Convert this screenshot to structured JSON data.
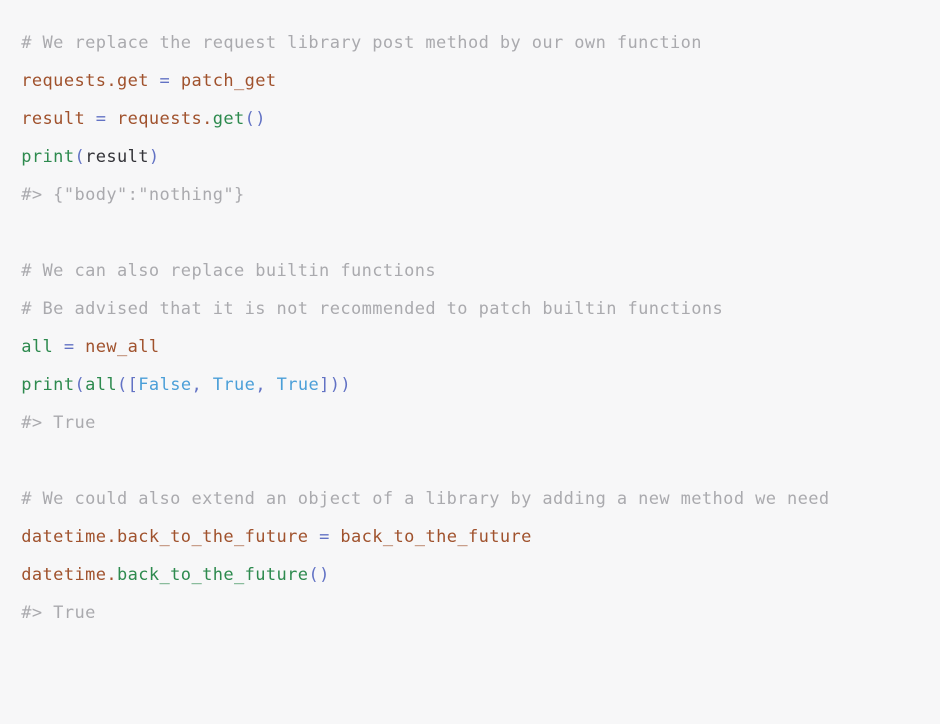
{
  "block": {
    "name": "python-code-snippet",
    "language": "python",
    "background_color": "#f7f7f8",
    "font_size_px": 17,
    "line_height_px": 38
  },
  "palette": {
    "comment": "#aaaaae",
    "name": "#a0522d",
    "function": "#2d8a4e",
    "operator": "#6272c4",
    "punctuation": "#6272c4",
    "boolean": "#4b9fd8",
    "plain": "#333338",
    "background": "#f7f7f8"
  },
  "lines": [
    {
      "id": "line-1",
      "kind": "comment",
      "text": "  # We replace the request library post method by our own function",
      "tokens": [
        {
          "t": "  ",
          "c": "ws"
        },
        {
          "t": "# We replace the request library post method by our own function",
          "c": "comment"
        }
      ]
    },
    {
      "id": "line-2",
      "kind": "code",
      "text": "  requests.get = patch_get",
      "tokens": [
        {
          "t": "  ",
          "c": "ws"
        },
        {
          "t": "requests.get",
          "c": "name"
        },
        {
          "t": " ",
          "c": "ws"
        },
        {
          "t": "=",
          "c": "op"
        },
        {
          "t": " ",
          "c": "ws"
        },
        {
          "t": "patch_get",
          "c": "name"
        }
      ]
    },
    {
      "id": "line-3",
      "kind": "code",
      "text": "  result = requests.get()",
      "tokens": [
        {
          "t": "  ",
          "c": "ws"
        },
        {
          "t": "result",
          "c": "name"
        },
        {
          "t": " ",
          "c": "ws"
        },
        {
          "t": "=",
          "c": "op"
        },
        {
          "t": " ",
          "c": "ws"
        },
        {
          "t": "requests.",
          "c": "name"
        },
        {
          "t": "get",
          "c": "func"
        },
        {
          "t": "()",
          "c": "punc"
        }
      ]
    },
    {
      "id": "line-4",
      "kind": "code",
      "text": "  print(result)",
      "tokens": [
        {
          "t": "  ",
          "c": "ws"
        },
        {
          "t": "print",
          "c": "func"
        },
        {
          "t": "(",
          "c": "punc"
        },
        {
          "t": "result",
          "c": "plain"
        },
        {
          "t": ")",
          "c": "punc"
        }
      ]
    },
    {
      "id": "line-5",
      "kind": "comment",
      "text": "  #> {\"body\":\"nothing\"}",
      "tokens": [
        {
          "t": "  ",
          "c": "ws"
        },
        {
          "t": "#> {\"body\":\"nothing\"}",
          "c": "comment"
        }
      ]
    },
    {
      "id": "line-6",
      "kind": "blank",
      "text": "",
      "tokens": []
    },
    {
      "id": "line-7",
      "kind": "comment",
      "text": "  # We can also replace builtin functions",
      "tokens": [
        {
          "t": "  ",
          "c": "ws"
        },
        {
          "t": "# We can also replace builtin functions",
          "c": "comment"
        }
      ]
    },
    {
      "id": "line-8",
      "kind": "comment",
      "text": "  # Be advised that it is not recommended to patch builtin functions",
      "tokens": [
        {
          "t": "  ",
          "c": "ws"
        },
        {
          "t": "# Be advised that it is not recommended to patch builtin functions",
          "c": "comment"
        }
      ]
    },
    {
      "id": "line-9",
      "kind": "code",
      "text": "  all = new_all",
      "tokens": [
        {
          "t": "  ",
          "c": "ws"
        },
        {
          "t": "all",
          "c": "func"
        },
        {
          "t": " ",
          "c": "ws"
        },
        {
          "t": "=",
          "c": "op"
        },
        {
          "t": " ",
          "c": "ws"
        },
        {
          "t": "new_all",
          "c": "name"
        }
      ]
    },
    {
      "id": "line-10",
      "kind": "code",
      "text": "  print(all([False, True, True]))",
      "tokens": [
        {
          "t": "  ",
          "c": "ws"
        },
        {
          "t": "print",
          "c": "func"
        },
        {
          "t": "(",
          "c": "punc"
        },
        {
          "t": "all",
          "c": "func"
        },
        {
          "t": "([",
          "c": "punc"
        },
        {
          "t": "False",
          "c": "bool"
        },
        {
          "t": ",",
          "c": "punc"
        },
        {
          "t": " ",
          "c": "ws"
        },
        {
          "t": "True",
          "c": "bool"
        },
        {
          "t": ",",
          "c": "punc"
        },
        {
          "t": " ",
          "c": "ws"
        },
        {
          "t": "True",
          "c": "bool"
        },
        {
          "t": "]))",
          "c": "punc"
        }
      ]
    },
    {
      "id": "line-11",
      "kind": "comment",
      "text": "  #> True",
      "tokens": [
        {
          "t": "  ",
          "c": "ws"
        },
        {
          "t": "#> True",
          "c": "comment"
        }
      ]
    },
    {
      "id": "line-12",
      "kind": "blank",
      "text": "",
      "tokens": []
    },
    {
      "id": "line-13",
      "kind": "comment",
      "text": "  # We could also extend an object of a library by adding a new method we need",
      "tokens": [
        {
          "t": "  ",
          "c": "ws"
        },
        {
          "t": "# We could also extend an object of a library by adding a new method we need",
          "c": "comment"
        }
      ]
    },
    {
      "id": "line-14",
      "kind": "code",
      "text": "  datetime.back_to_the_future = back_to_the_future",
      "tokens": [
        {
          "t": "  ",
          "c": "ws"
        },
        {
          "t": "datetime.back_to_the_future",
          "c": "name"
        },
        {
          "t": " ",
          "c": "ws"
        },
        {
          "t": "=",
          "c": "op"
        },
        {
          "t": " ",
          "c": "ws"
        },
        {
          "t": "back_to_the_future",
          "c": "name"
        }
      ]
    },
    {
      "id": "line-15",
      "kind": "code",
      "text": "  datetime.back_to_the_future()",
      "tokens": [
        {
          "t": "  ",
          "c": "ws"
        },
        {
          "t": "datetime.",
          "c": "name"
        },
        {
          "t": "back_to_the_future",
          "c": "func"
        },
        {
          "t": "()",
          "c": "punc"
        }
      ]
    },
    {
      "id": "line-16",
      "kind": "comment",
      "text": "  #> True",
      "tokens": [
        {
          "t": "  ",
          "c": "ws"
        },
        {
          "t": "#> True",
          "c": "comment"
        }
      ]
    }
  ]
}
